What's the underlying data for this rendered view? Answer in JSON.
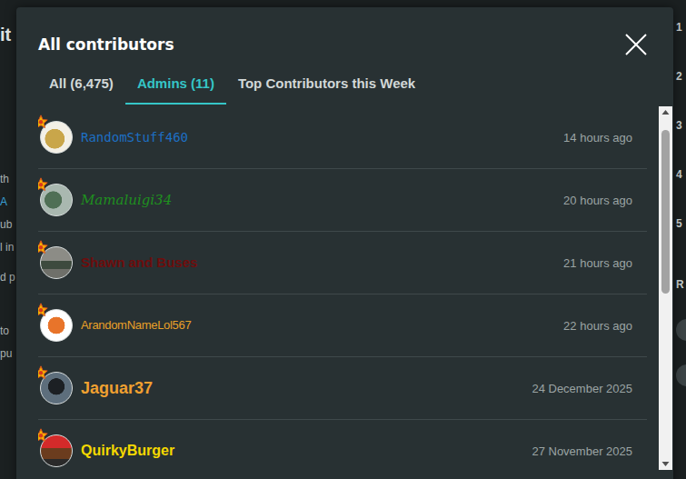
{
  "background": {
    "left_fragments": [
      "it",
      "th",
      "A",
      "ub",
      "l in",
      "d p",
      "to",
      "pu"
    ],
    "right_fragments": [
      "1",
      "2",
      "3",
      "4",
      "5",
      "R"
    ]
  },
  "dialog": {
    "title": "All contributors"
  },
  "tabs": [
    {
      "label": "All (6,475)",
      "selected": false
    },
    {
      "label": "Admins (11)",
      "selected": true
    },
    {
      "label": "Top Contributors this Week",
      "selected": false
    }
  ],
  "contributors": [
    {
      "name": "RandomStuff460",
      "time": "14 hours ago",
      "color": "#1d6fc4"
    },
    {
      "name": "Mamaluigi34",
      "time": "20 hours ago",
      "color": "#1f8f1f"
    },
    {
      "name": "Shawn and Buses",
      "time": "21 hours ago",
      "color": "#6e0d0d"
    },
    {
      "name": "ArandomNameLol567",
      "time": "22 hours ago",
      "color": "#e8a028"
    },
    {
      "name": "Jaguar37",
      "time": "24 December 2025",
      "color": "#f0a030"
    },
    {
      "name": "QuirkyBurger",
      "time": "27 November 2025",
      "color": "#f5d800"
    }
  ]
}
